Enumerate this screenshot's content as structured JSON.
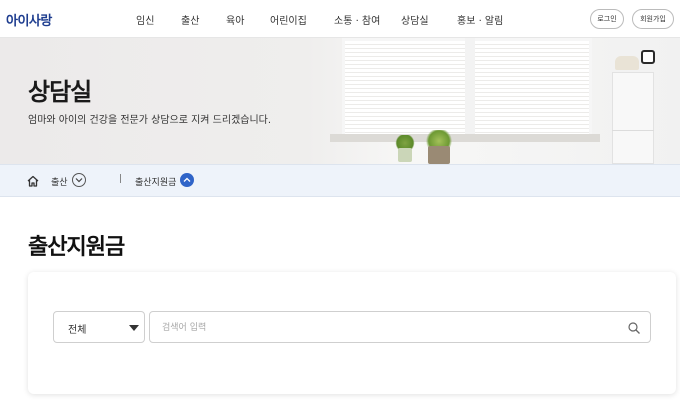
{
  "header": {
    "logo": "아이사랑",
    "nav": [
      "임신",
      "출산",
      "육아",
      "어린이집",
      "소통 · 참여",
      "상담실",
      "홍보 · 알림"
    ],
    "login": "로그인",
    "signup": "회원가입"
  },
  "hero": {
    "title": "상담실",
    "subtitle": "엄마와 아이의 건강을 전문가 상담으로 지켜 드리겠습니다."
  },
  "breadcrumb": {
    "home_icon": "home-icon",
    "level1": "출산",
    "separator": "|",
    "level2": "출산지원금"
  },
  "main": {
    "title": "출산지원금",
    "filter": {
      "selected": "전체",
      "search_placeholder": "검색어 입력",
      "search_value": ""
    }
  },
  "colors": {
    "brand": "#1e3d8f",
    "accent": "#2f64c8",
    "breadcrumb_bg": "#eef3fa"
  }
}
